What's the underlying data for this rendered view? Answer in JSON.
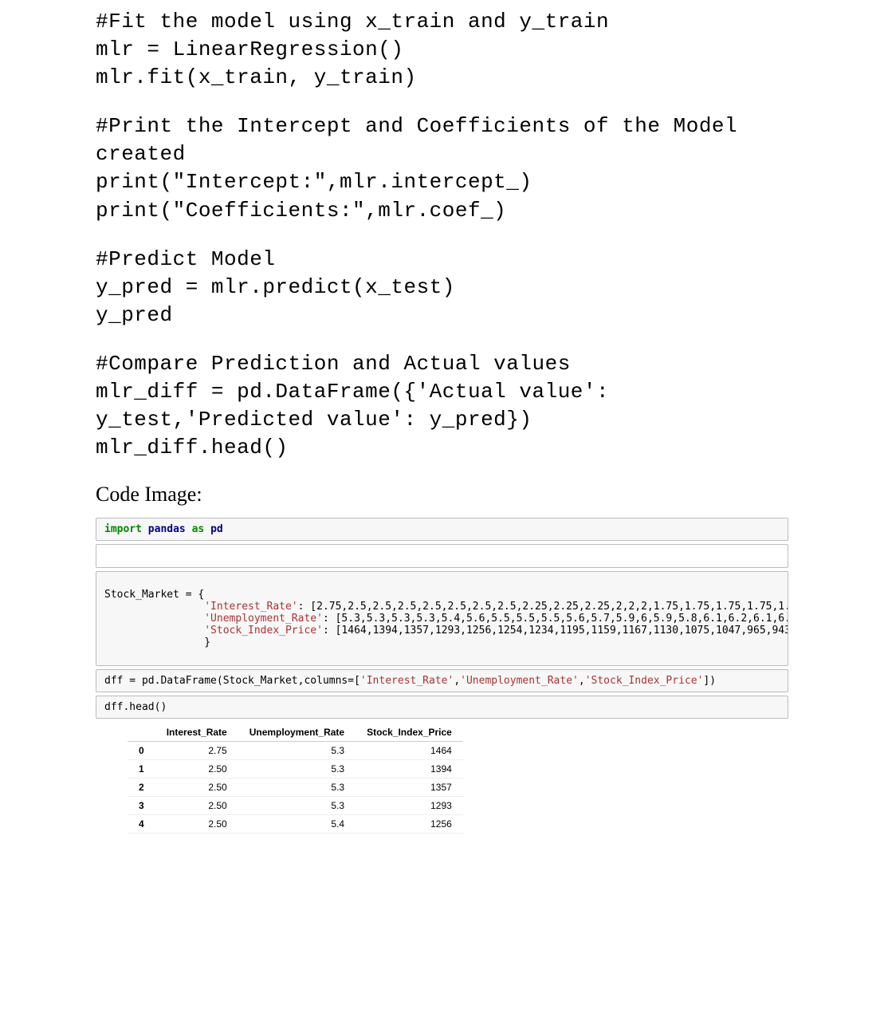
{
  "code": {
    "b1": "#Fit the model using x_train and y_train\nmlr = LinearRegression()\nmlr.fit(x_train, y_train)",
    "b2": "#Print the Intercept and Coefficients of the Model created\nprint(\"Intercept:\",mlr.intercept_)\nprint(\"Coefficients:\",mlr.coef_)",
    "b3": "#Predict Model\ny_pred = mlr.predict(x_test)\ny_pred",
    "b4": "#Compare Prediction and Actual values\nmlr_diff = pd.DataFrame({'Actual value': y_test,'Predicted value': y_pred})\nmlr_diff.head()"
  },
  "heading": "Code Image:",
  "notebook": {
    "import_line": "import pandas as pd",
    "stock_market_label": "Stock_Market = {",
    "stock_market_dict": "'Interest_Rate': [2.75,2.5,2.5,2.5,2.5,2.5,2.5,2.5,2.25,2.25,2.25,2,2,2,1.75,1.75,1.75,1.75,1.75,1.75,1.75,1.75,1.75,1.75,\n                'Unemployment_Rate': [5.3,5.3,5.3,5.3,5.4,5.6,5.5,5.5,5.5,5.6,5.7,5.9,6,5.9,5.8,6.1,6.2,6.1,6.1,6.1,5.9,6.2,6.2,\n                'Stock_Index_Price': [1464,1394,1357,1293,1256,1254,1234,1195,1159,1167,1130,1075,1047,965,943,958,971,949,884,\n                }",
    "dff_line": "dff = pd.DataFrame(Stock_Market,columns=['Interest_Rate','Unemployment_Rate','Stock_Index_Price'])",
    "head_line": "dff.head()"
  },
  "table": {
    "headers": [
      "",
      "Interest_Rate",
      "Unemployment_Rate",
      "Stock_Index_Price"
    ],
    "rows": [
      [
        "0",
        "2.75",
        "5.3",
        "1464"
      ],
      [
        "1",
        "2.50",
        "5.3",
        "1394"
      ],
      [
        "2",
        "2.50",
        "5.3",
        "1357"
      ],
      [
        "3",
        "2.50",
        "5.3",
        "1293"
      ],
      [
        "4",
        "2.50",
        "5.4",
        "1256"
      ]
    ]
  }
}
